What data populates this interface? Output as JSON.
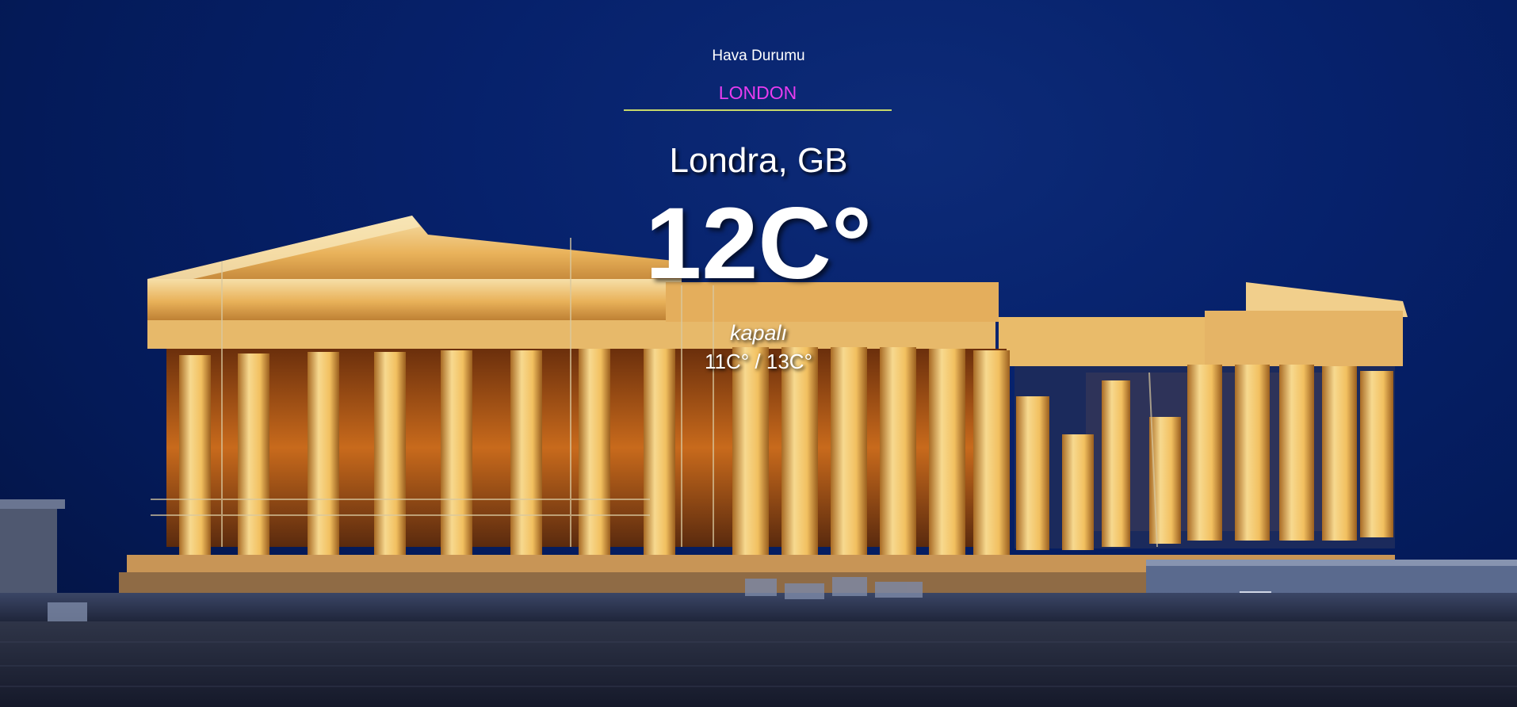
{
  "app": {
    "title": "Hava Durumu"
  },
  "search": {
    "value": "LONDON",
    "text_color": "#e83cf0",
    "underline_color": "#c7d86a"
  },
  "weather": {
    "location": "Londra, GB",
    "temperature": "12C°",
    "description": "kapalı",
    "range": "11C° / 13C°"
  },
  "background": {
    "subject": "parthenon-at-night",
    "sky_color": "#06216b",
    "light_color": "#f2b54a"
  }
}
